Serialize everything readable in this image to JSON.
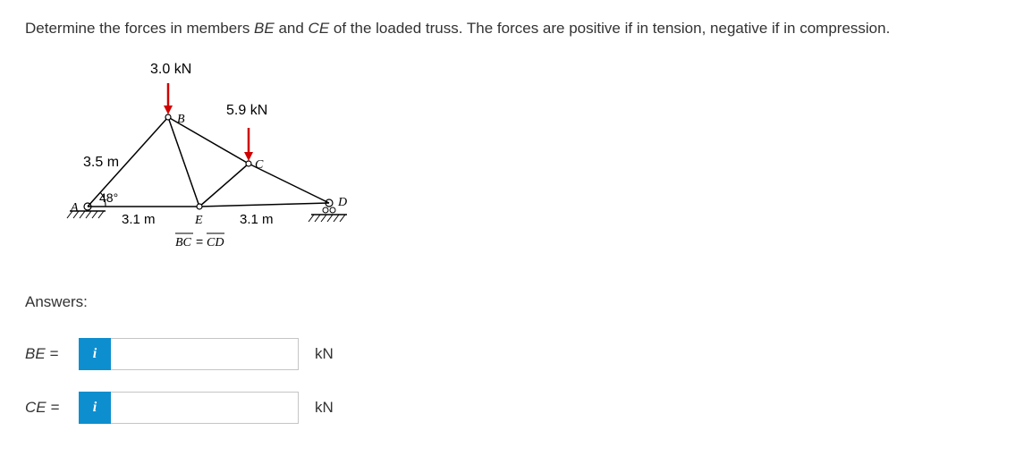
{
  "question": {
    "prefix": "Determine the forces in members ",
    "member1": "BE",
    "middle": " and ",
    "member2": "CE",
    "suffix": " of the loaded truss. The forces are positive if in tension, negative if in compression."
  },
  "diagram": {
    "load1": "3.0 kN",
    "load2": "5.9 kN",
    "length_AB": "3.5 m",
    "angle_A": "48°",
    "label_A": "A",
    "label_B": "B",
    "label_C": "C",
    "label_D": "D",
    "label_E": "E",
    "length_AE": "3.1 m",
    "length_ED": "3.1 m",
    "constraint": "BC = CD",
    "constraint_over1": "BC",
    "constraint_over2": "CD"
  },
  "answers": {
    "title": "Answers:",
    "BE_label": "BE =",
    "BE_value": "",
    "CE_label": "CE =",
    "CE_value": "",
    "unit": "kN",
    "info_icon": "i"
  }
}
